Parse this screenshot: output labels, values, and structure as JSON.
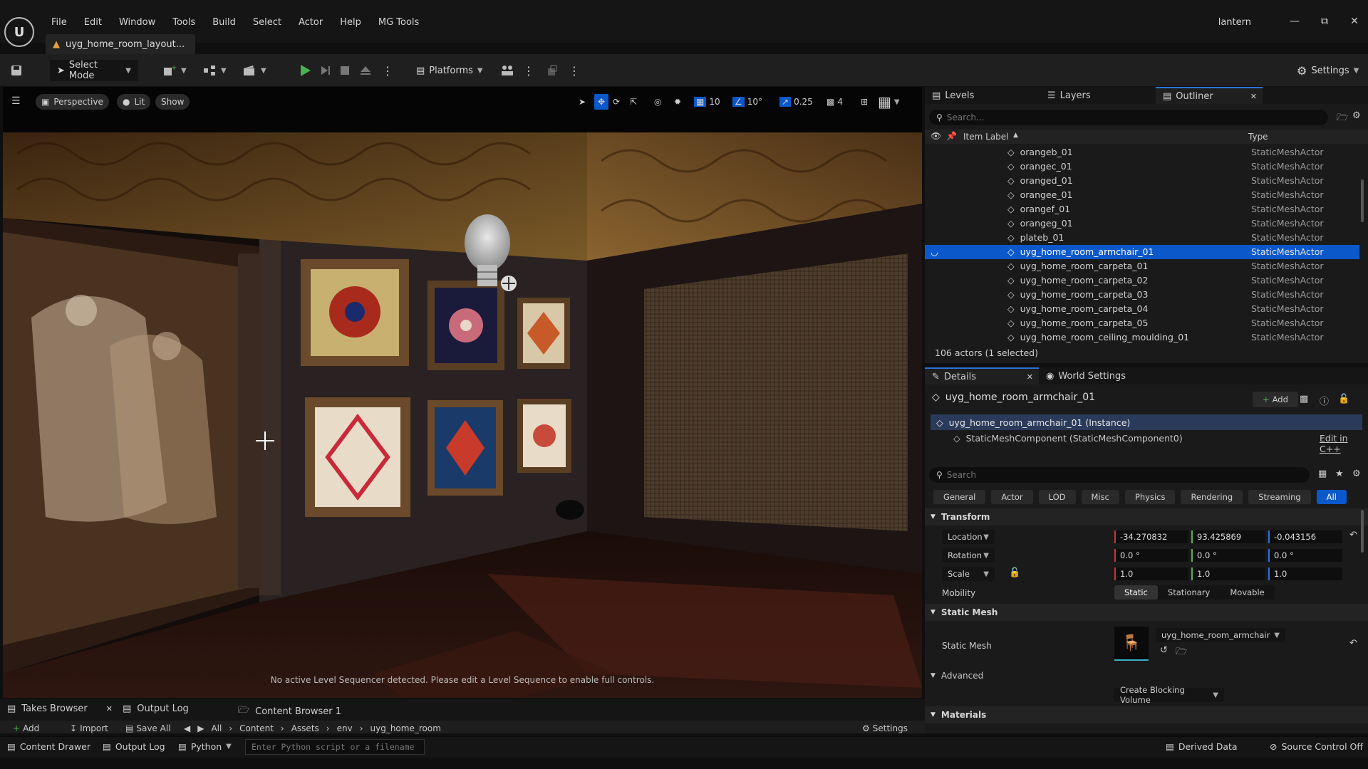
{
  "app": {
    "logo": "U",
    "menu": [
      "File",
      "Edit",
      "Window",
      "Tools",
      "Build",
      "Select",
      "Actor",
      "Help",
      "MG Tools"
    ],
    "project": "lantern",
    "doc_tab": "uyg_home_room_layout..."
  },
  "toolbar": {
    "select_mode": "Select Mode",
    "platforms": "Platforms",
    "settings": "Settings"
  },
  "viewport": {
    "perspective": "Perspective",
    "lit": "Lit",
    "show": "Show",
    "grid_snap": "10",
    "rot_snap": "10°",
    "scale_snap": "0.25",
    "cam_speed": "4",
    "message": "No active Level Sequencer detected. Please edit a Level Sequence to enable full controls."
  },
  "outliner": {
    "tabs": [
      "Levels",
      "Layers",
      "Outliner"
    ],
    "search_placeholder": "Search...",
    "col_label": "Item Label",
    "col_type": "Type",
    "rows": [
      {
        "label": "orangeb_01",
        "type": "StaticMeshActor"
      },
      {
        "label": "orangec_01",
        "type": "StaticMeshActor"
      },
      {
        "label": "oranged_01",
        "type": "StaticMeshActor"
      },
      {
        "label": "orangee_01",
        "type": "StaticMeshActor"
      },
      {
        "label": "orangef_01",
        "type": "StaticMeshActor"
      },
      {
        "label": "orangeg_01",
        "type": "StaticMeshActor"
      },
      {
        "label": "plateb_01",
        "type": "StaticMeshActor"
      },
      {
        "label": "uyg_home_room_armchair_01",
        "type": "StaticMeshActor"
      },
      {
        "label": "uyg_home_room_carpeta_01",
        "type": "StaticMeshActor"
      },
      {
        "label": "uyg_home_room_carpeta_02",
        "type": "StaticMeshActor"
      },
      {
        "label": "uyg_home_room_carpeta_03",
        "type": "StaticMeshActor"
      },
      {
        "label": "uyg_home_room_carpeta_04",
        "type": "StaticMeshActor"
      },
      {
        "label": "uyg_home_room_carpeta_05",
        "type": "StaticMeshActor"
      },
      {
        "label": "uyg_home_room_ceiling_moulding_01",
        "type": "StaticMeshActor"
      }
    ],
    "selected_index": 7,
    "count": "106 actors (1 selected)"
  },
  "details": {
    "tabs": [
      "Details",
      "World Settings"
    ],
    "actor_name": "uyg_home_room_armchair_01",
    "add": "Add",
    "instance": "uyg_home_room_armchair_01 (Instance)",
    "component": "StaticMeshComponent (StaticMeshComponent0)",
    "edit_cpp": "Edit in C++",
    "search_placeholder": "Search",
    "filters": [
      "General",
      "Actor",
      "LOD",
      "Misc",
      "Physics",
      "Rendering",
      "Streaming",
      "All"
    ],
    "active_filter": "All",
    "transform": "Transform",
    "location_label": "Location",
    "location": [
      "-34.270832",
      "93.425869",
      "-0.043156"
    ],
    "rotation_label": "Rotation",
    "rotation": [
      "0.0 °",
      "0.0 °",
      "0.0 °"
    ],
    "scale_label": "Scale",
    "scale": [
      "1.0",
      "1.0",
      "1.0"
    ],
    "mobility_label": "Mobility",
    "mobility": [
      "Static",
      "Stationary",
      "Movable"
    ],
    "mobility_selected": "Static",
    "static_mesh_section": "Static Mesh",
    "static_mesh_label": "Static Mesh",
    "static_mesh_value": "uyg_home_room_armchair",
    "advanced": "Advanced",
    "blocking_volume": "Create Blocking Volume",
    "materials": "Materials"
  },
  "bottom": {
    "tabs": [
      "Takes Browser",
      "Output Log",
      "Content Browser 1"
    ],
    "cb_add": "Add",
    "cb_import": "Import",
    "cb_save": "Save All",
    "cb_path": [
      "All",
      "Content",
      "Assets",
      "env",
      "uyg_home_room"
    ],
    "cb_settings": "Settings"
  },
  "statusbar": {
    "content_drawer": "Content Drawer",
    "output_log": "Output Log",
    "python": "Python",
    "python_placeholder": "Enter Python script or a filename",
    "derived_data": "Derived Data",
    "source_control": "Source Control Off"
  },
  "colors": {
    "accent": "#0a58ca",
    "play_green": "#4caf50"
  }
}
